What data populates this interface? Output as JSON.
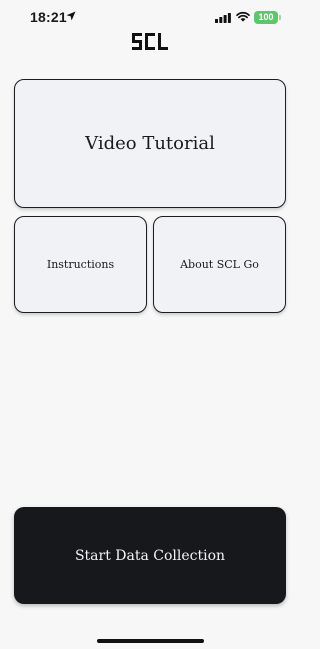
{
  "status_bar": {
    "time": "18:21",
    "battery": "100",
    "icons": [
      "location-arrow-icon",
      "cellular-signal-icon",
      "wifi-icon",
      "battery-icon"
    ],
    "battery_color": "#5cc86b"
  },
  "header": {
    "logo_icon": "scl-logo"
  },
  "cards": {
    "video_tutorial": "Video Tutorial",
    "instructions": "Instructions",
    "about": "About SCL Go"
  },
  "primary_action": {
    "label": "Start Data Collection",
    "color": "#16181b"
  },
  "colors": {
    "background": "#f7f7f7",
    "card_fill": "#f1f2f6",
    "card_border": "#1c1d21"
  }
}
